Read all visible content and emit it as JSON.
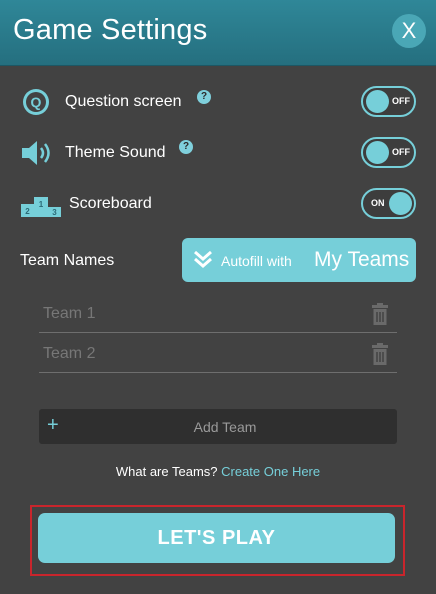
{
  "header": {
    "title": "Game Settings",
    "close_label": "X"
  },
  "settings": [
    {
      "label": "Question screen",
      "help": "?",
      "state_label": "OFF",
      "state": "off"
    },
    {
      "label": "Theme Sound",
      "help": "?",
      "state_label": "OFF",
      "state": "off"
    },
    {
      "label": "Scoreboard",
      "state_label": "ON",
      "state": "on"
    }
  ],
  "podium_icon": {
    "numbers": [
      "2",
      "1",
      "3"
    ]
  },
  "team_names": {
    "label": "Team Names",
    "autofill_small": "Autofill with",
    "autofill_big": "My Teams",
    "fields": [
      {
        "placeholder": "Team 1",
        "value": ""
      },
      {
        "placeholder": "Team 2",
        "value": ""
      }
    ],
    "add_team_label": "Add Team",
    "add_team_icon": "+"
  },
  "teams_info": {
    "question": "What are Teams?",
    "link": "Create One Here"
  },
  "play": {
    "label": "LET'S PLAY"
  },
  "colors": {
    "accent": "#76cfd9",
    "header": "#2a7f8f",
    "background": "#424242",
    "highlight_border": "#c9252c"
  }
}
